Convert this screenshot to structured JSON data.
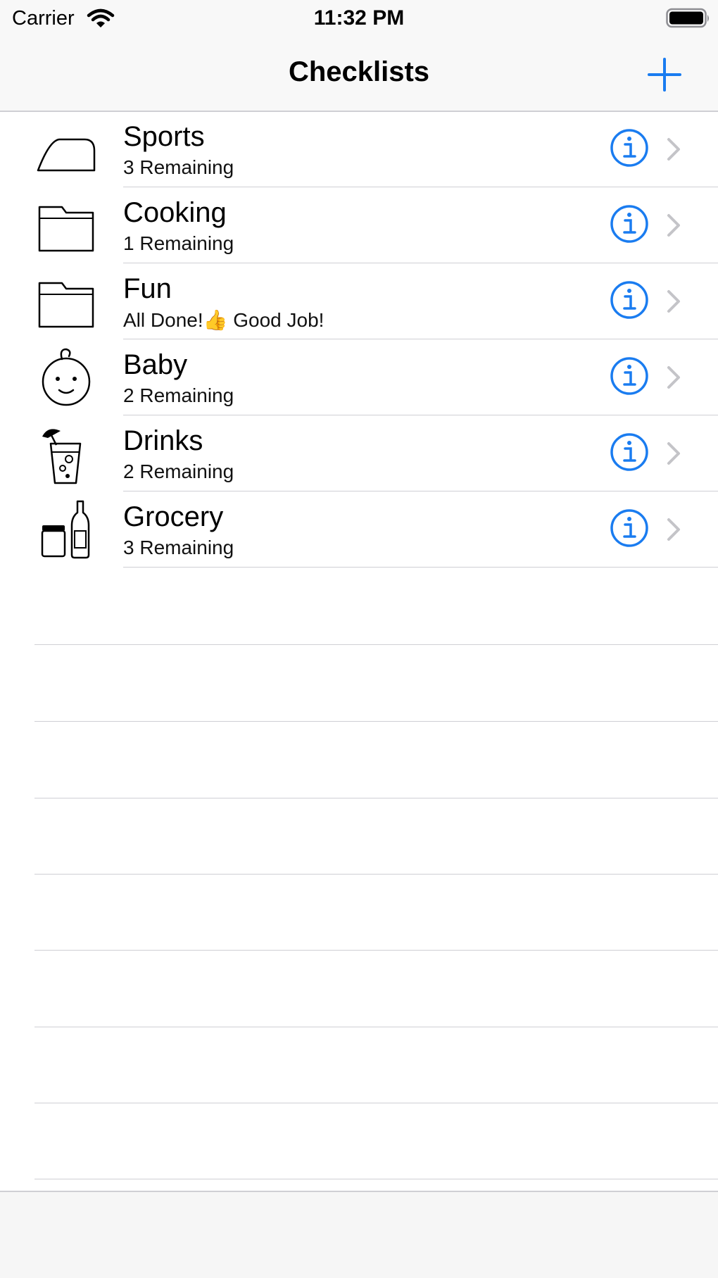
{
  "status_bar": {
    "carrier": "Carrier",
    "time": "11:32 PM"
  },
  "nav": {
    "title": "Checklists",
    "add_icon": "plus-icon"
  },
  "colors": {
    "accent": "#1a7cf0",
    "separator": "#cfcfd4",
    "chevron": "#c4c4c8",
    "bar_background": "#f8f8f8"
  },
  "checklists": [
    {
      "title": "Sports",
      "subtitle": "3 Remaining",
      "icon": "iron-icon"
    },
    {
      "title": "Cooking",
      "subtitle": "1 Remaining",
      "icon": "folder-icon"
    },
    {
      "title": "Fun",
      "subtitle": "All Done!👍 Good Job!",
      "icon": "folder-icon"
    },
    {
      "title": "Baby",
      "subtitle": "2 Remaining",
      "icon": "baby-face-icon"
    },
    {
      "title": "Drinks",
      "subtitle": "2 Remaining",
      "icon": "cocktail-glass-icon"
    },
    {
      "title": "Grocery",
      "subtitle": "3 Remaining",
      "icon": "jar-and-bottle-icon"
    }
  ]
}
